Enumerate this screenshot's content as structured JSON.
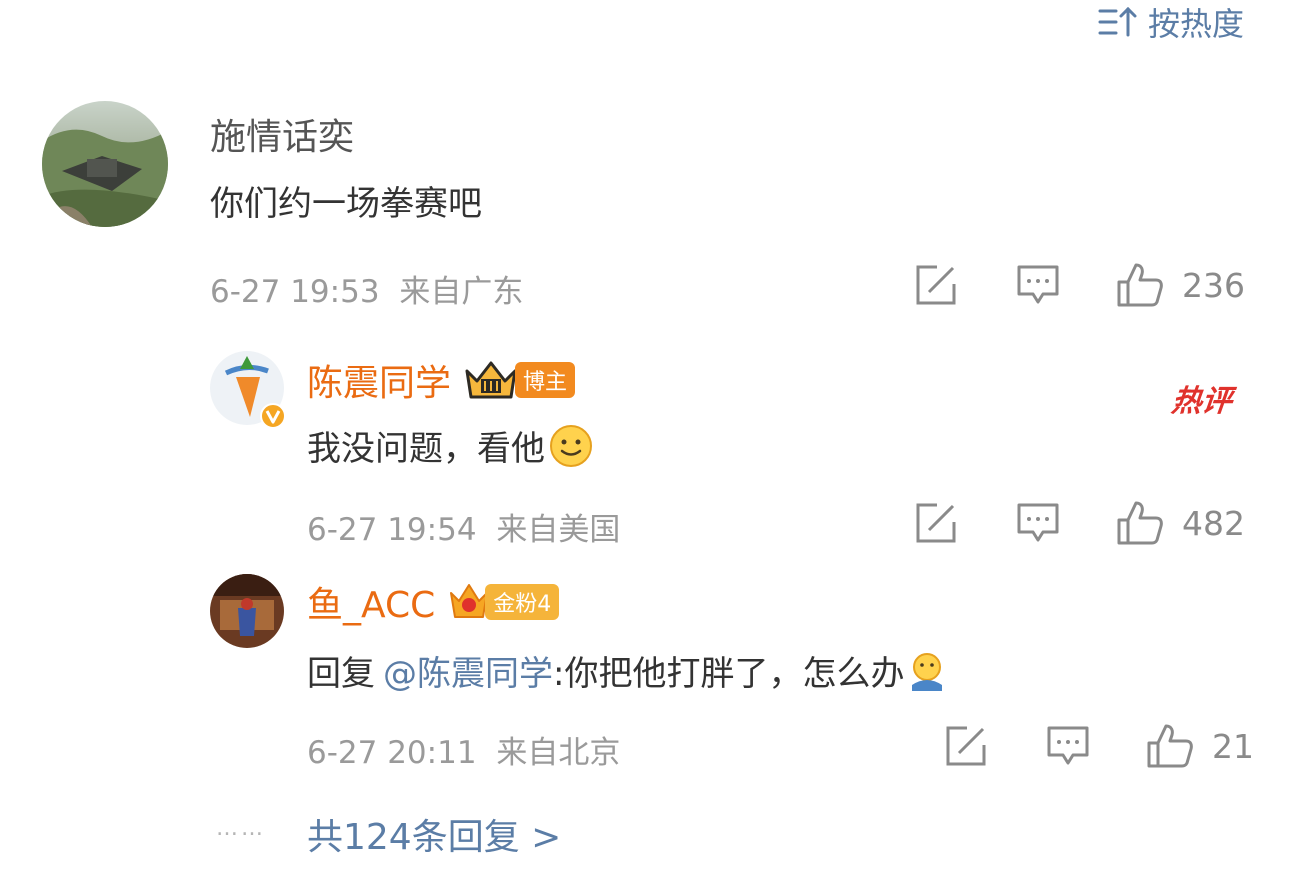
{
  "sort": {
    "label": "按热度"
  },
  "comment": {
    "author": "施情话奕",
    "text": "你们约一场拳赛吧",
    "time": "6-27 19:53",
    "location": "来自广东",
    "likes": "236"
  },
  "replies": [
    {
      "author": "陈震同学",
      "badge": "博主",
      "hot_label": "热评",
      "text": "我没问题，看他",
      "time": "6-27 19:54",
      "location": "来自美国",
      "likes": "482"
    },
    {
      "author": "鱼_ACC",
      "badge": "金粉4",
      "reply_prefix": "回复",
      "mention": "@陈震同学",
      "text": ":你把他打胖了，怎么办",
      "time": "6-27 20:11",
      "location": "来自北京",
      "likes": "21"
    }
  ],
  "more_replies": {
    "dots": "……",
    "label": "共124条回复 >"
  },
  "colors": {
    "accent_blue": "#5b7da6",
    "name_orange": "#ea6b12",
    "meta_gray": "#9a9a9a",
    "hot_red": "#e0322c"
  }
}
